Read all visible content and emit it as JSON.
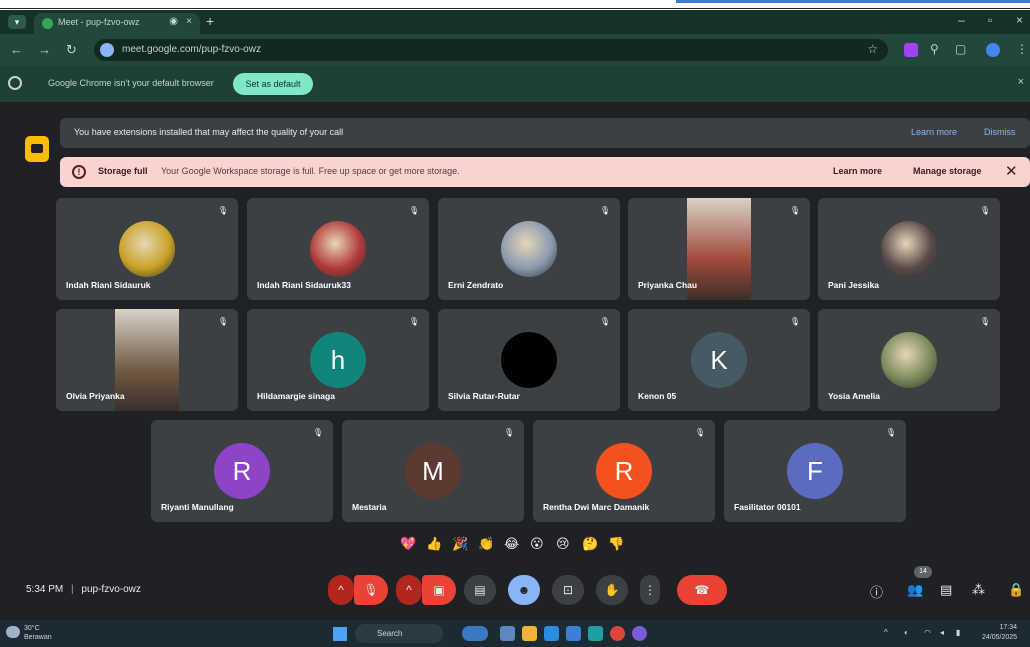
{
  "browser": {
    "tab_title": "Meet - pup-fzvo-owz",
    "url": "meet.google.com/pup-fzvo-owz",
    "infobar_message": "Google Chrome isn't your default browser",
    "infobar_button": "Set as default"
  },
  "banners": {
    "extensions_text": "You have extensions installed that may affect the quality of your call",
    "extensions_learn": "Learn more",
    "extensions_dismiss": "Dismiss",
    "storage_title": "Storage full",
    "storage_text": "Your Google Workspace storage is full. Free up space or get more storage.",
    "storage_learn": "Learn more",
    "storage_manage": "Manage storage"
  },
  "participants": [
    {
      "name": "Indah Riani Sidauruk",
      "avatar_type": "photo",
      "color": "#c9a227"
    },
    {
      "name": "Indah Riani Sidauruk33",
      "avatar_type": "photo",
      "color": "#b23a3a"
    },
    {
      "name": "Erni Zendrato",
      "avatar_type": "photo",
      "color": "#8a9bb0"
    },
    {
      "name": "Priyanka Chau",
      "avatar_type": "video",
      "color": "#a14b3c"
    },
    {
      "name": "Pani Jessika",
      "avatar_type": "photo",
      "color": "#5a4a4a"
    },
    {
      "name": "Olvia Priyanka",
      "avatar_type": "video",
      "color": "#6f5a44"
    },
    {
      "name": "Hildamargie sinaga",
      "avatar_type": "initial",
      "initial": "h",
      "color": "#12857a"
    },
    {
      "name": "Silvia Rutar-Rutar",
      "avatar_type": "initial",
      "initial": "",
      "color": "#000000"
    },
    {
      "name": "Kenon 05",
      "avatar_type": "initial",
      "initial": "K",
      "color": "#455a64"
    },
    {
      "name": "Yosia Amelia",
      "avatar_type": "photo",
      "color": "#7a8a5a"
    },
    {
      "name": "Riyanti Manullang",
      "avatar_type": "initial",
      "initial": "R",
      "color": "#8e44c9"
    },
    {
      "name": "Mestaria",
      "avatar_type": "initial",
      "initial": "M",
      "color": "#5d3a31"
    },
    {
      "name": "Rentha Dwi Marc Damanik",
      "avatar_type": "initial",
      "initial": "R",
      "color": "#f4511e"
    },
    {
      "name": "Fasilitator 00101",
      "avatar_type": "initial",
      "initial": "F",
      "color": "#5c6bc0"
    }
  ],
  "reactions": [
    "💖",
    "👍",
    "🎉",
    "👏",
    "😂",
    "😮",
    "😢",
    "🤔",
    "👎"
  ],
  "bottom_bar": {
    "time": "5:34 PM",
    "separator": "|",
    "meeting_code": "pup-fzvo-owz",
    "people_count": "14"
  },
  "taskbar": {
    "temp": "30°C",
    "weather": "Berawan",
    "search_placeholder": "Search",
    "clock_time": "17:34",
    "clock_date": "24/05/2025"
  },
  "colors": {
    "meet_bg": "#202124",
    "tile_bg": "#3c4043",
    "storage_bg": "#fad2cf",
    "chrome_bg": "#1e4136",
    "end_call": "#ea4335",
    "accent_blue": "#8ab4f8"
  }
}
